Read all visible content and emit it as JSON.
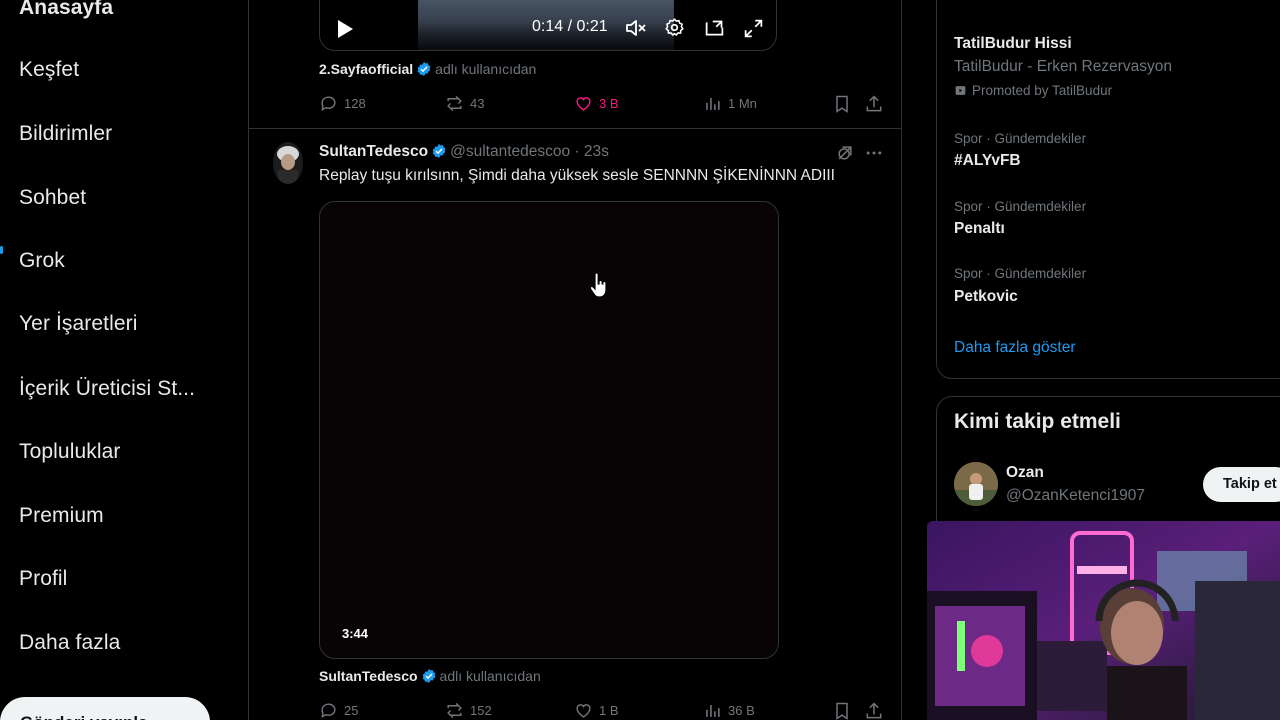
{
  "nav": {
    "items": [
      "Anasayfa",
      "Keşfet",
      "Bildirimler",
      "Sohbet",
      "Grok",
      "Yer İşaretleri",
      "İçerik Üreticisi St...",
      "Topluluklar",
      "Premium",
      "Profil",
      "Daha fazla"
    ],
    "post_button": "Gönderi yayınla"
  },
  "tweet1": {
    "video_time": "0:14 / 0:21",
    "byline_name": "2.Sayfaofficial",
    "byline_suffix": "adlı kullanıcıdan",
    "replies": "128",
    "reposts": "43",
    "likes": "3 B",
    "views": "1 Mn"
  },
  "tweet2": {
    "name": "SultanTedesco",
    "handle_time": "@sultantedescoo · 23s",
    "text": "Replay tuşu kırılsınn, Şimdi daha yüksek sesle SENNNN ŞİKENİNNN ADIII",
    "video_duration": "3:44",
    "byline_name": "SultanTedesco",
    "byline_suffix": "adlı kullanıcıdan",
    "replies": "25",
    "reposts": "152",
    "likes": "1 B",
    "views": "36 B"
  },
  "sidebar": {
    "ad": {
      "title": "TatilBudur Hissi",
      "desc": "TatilBudur - Erken Rezervasyon",
      "promoted": "Promoted by TatilBudur"
    },
    "trends": [
      {
        "category": "Spor · Gündemdekiler",
        "title": "#ALYvFB"
      },
      {
        "category": "Spor · Gündemdekiler",
        "title": "Penaltı"
      },
      {
        "category": "Spor · Gündemdekiler",
        "title": "Petkovic"
      }
    ],
    "show_more": "Daha fazla göster",
    "who_to_follow": {
      "title": "Kimi takip etmeli",
      "name": "Ozan",
      "handle": "@OzanKetenci1907",
      "button": "Takip et"
    }
  },
  "colors": {
    "background": "#000000",
    "accent": "#1d9bf0",
    "like_active": "#f91880",
    "muted_text": "#71767b",
    "border": "#2f3336"
  }
}
